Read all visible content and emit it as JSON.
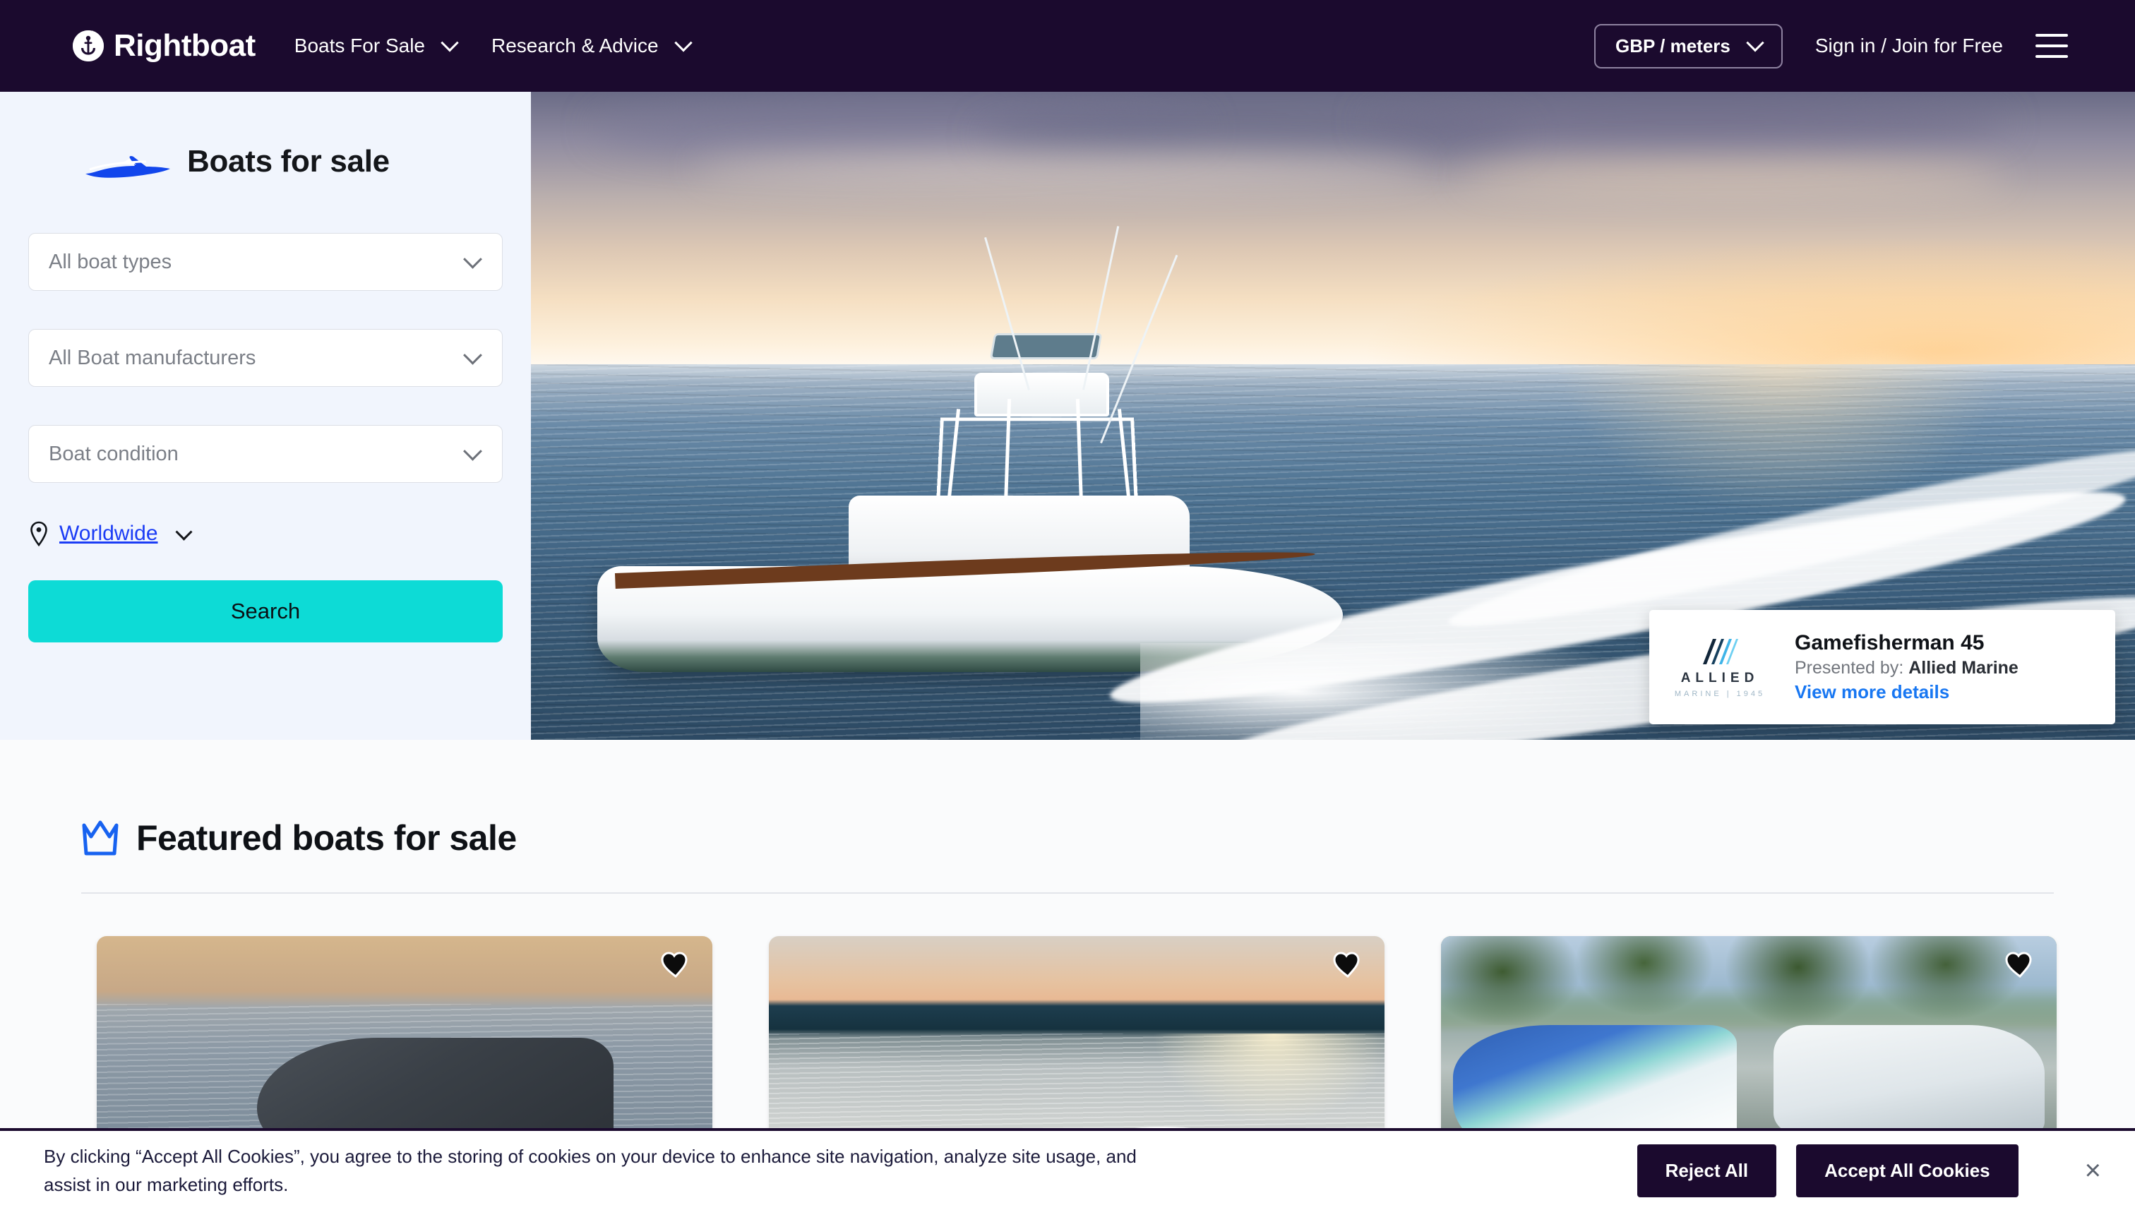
{
  "header": {
    "logo_text": "Rightboat",
    "logo_icon": "anchor-circle-icon",
    "nav": [
      {
        "label": "Boats For Sale",
        "icon": "chevron-down-icon"
      },
      {
        "label": "Research & Advice",
        "icon": "chevron-down-icon"
      }
    ],
    "unit_selector": {
      "label": "GBP / meters",
      "icon": "chevron-down-icon"
    },
    "signin_label": "Sign in / Join for Free",
    "menu_icon": "hamburger-menu-icon",
    "background_color": "#1B0A2E"
  },
  "hero": {
    "panel": {
      "title": "Boats for sale",
      "boat_icon": "speedboat-icon",
      "filters": [
        {
          "value": "All boat types",
          "icon": "chevron-down-icon"
        },
        {
          "value": "All Boat manufacturers",
          "icon": "chevron-down-icon"
        },
        {
          "value": "Boat condition",
          "icon": "chevron-down-icon"
        }
      ],
      "location": {
        "label": "Worldwide",
        "pin_icon": "map-pin-icon",
        "chevron": "chevron-down-icon"
      },
      "search_label": "Search",
      "search_color": "#0DDBD6",
      "panel_background": "#F1F5FD"
    },
    "listing_card": {
      "brand_mark": "allied-marine-logo-icon",
      "brand_name": "ALLIED",
      "brand_sub": "MARINE | 1945",
      "title": "Gamefisherman 45",
      "presented_prefix": "Presented by: ",
      "presented_by": "Allied Marine",
      "link_label": "View more details",
      "link_color": "#1877F2"
    }
  },
  "featured": {
    "crown_icon": "crown-icon",
    "title": "Featured boats for sale",
    "cards": [
      {
        "favourite_icon": "heart-icon",
        "photo": "dark-motor-yacht-at-sunset"
      },
      {
        "favourite_icon": "heart-icon",
        "photo": "lake-sunset-with-mountains"
      },
      {
        "favourite_icon": "heart-icon",
        "photo": "boats-moored-at-marina"
      }
    ]
  },
  "cookie_banner": {
    "text": "By clicking “Accept All Cookies”, you agree to the storing of cookies on your device to enhance site navigation, analyze site usage, and assist in our marketing efforts.",
    "reject_label": "Reject All",
    "accept_label": "Accept All Cookies",
    "close_icon": "close-icon",
    "close_glyph": "×"
  }
}
